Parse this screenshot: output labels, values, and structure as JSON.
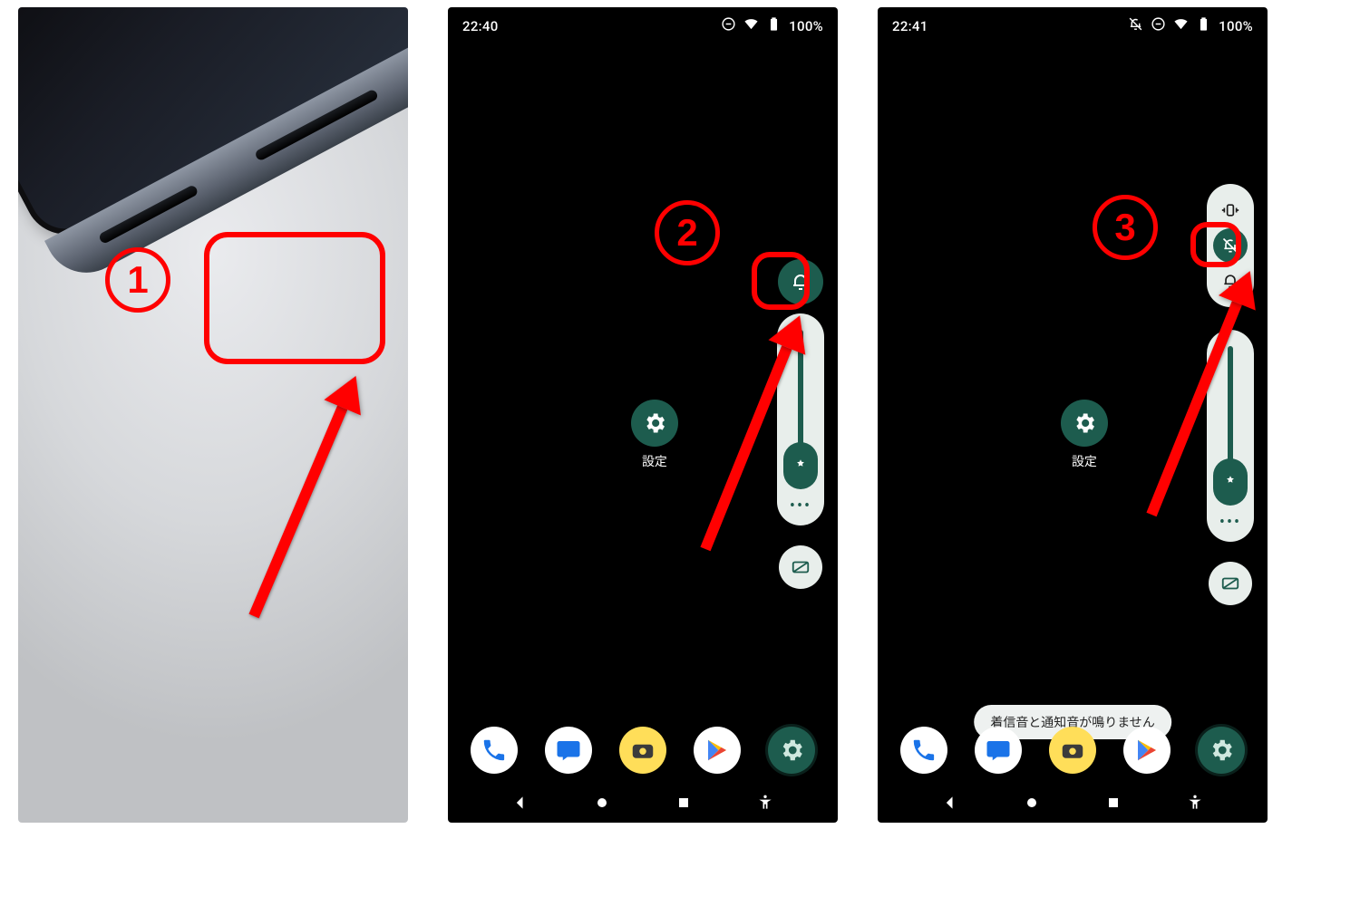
{
  "panel1": {
    "step_number": "1"
  },
  "panel2": {
    "step_number": "2",
    "status": {
      "time": "22:40",
      "battery": "100%"
    },
    "settings_label": "設定",
    "more_dots": "•••"
  },
  "panel3": {
    "step_number": "3",
    "status": {
      "time": "22:41",
      "battery": "100%"
    },
    "settings_label": "設定",
    "more_dots": "•••",
    "toast": "着信音と通知音が鳴りません"
  }
}
